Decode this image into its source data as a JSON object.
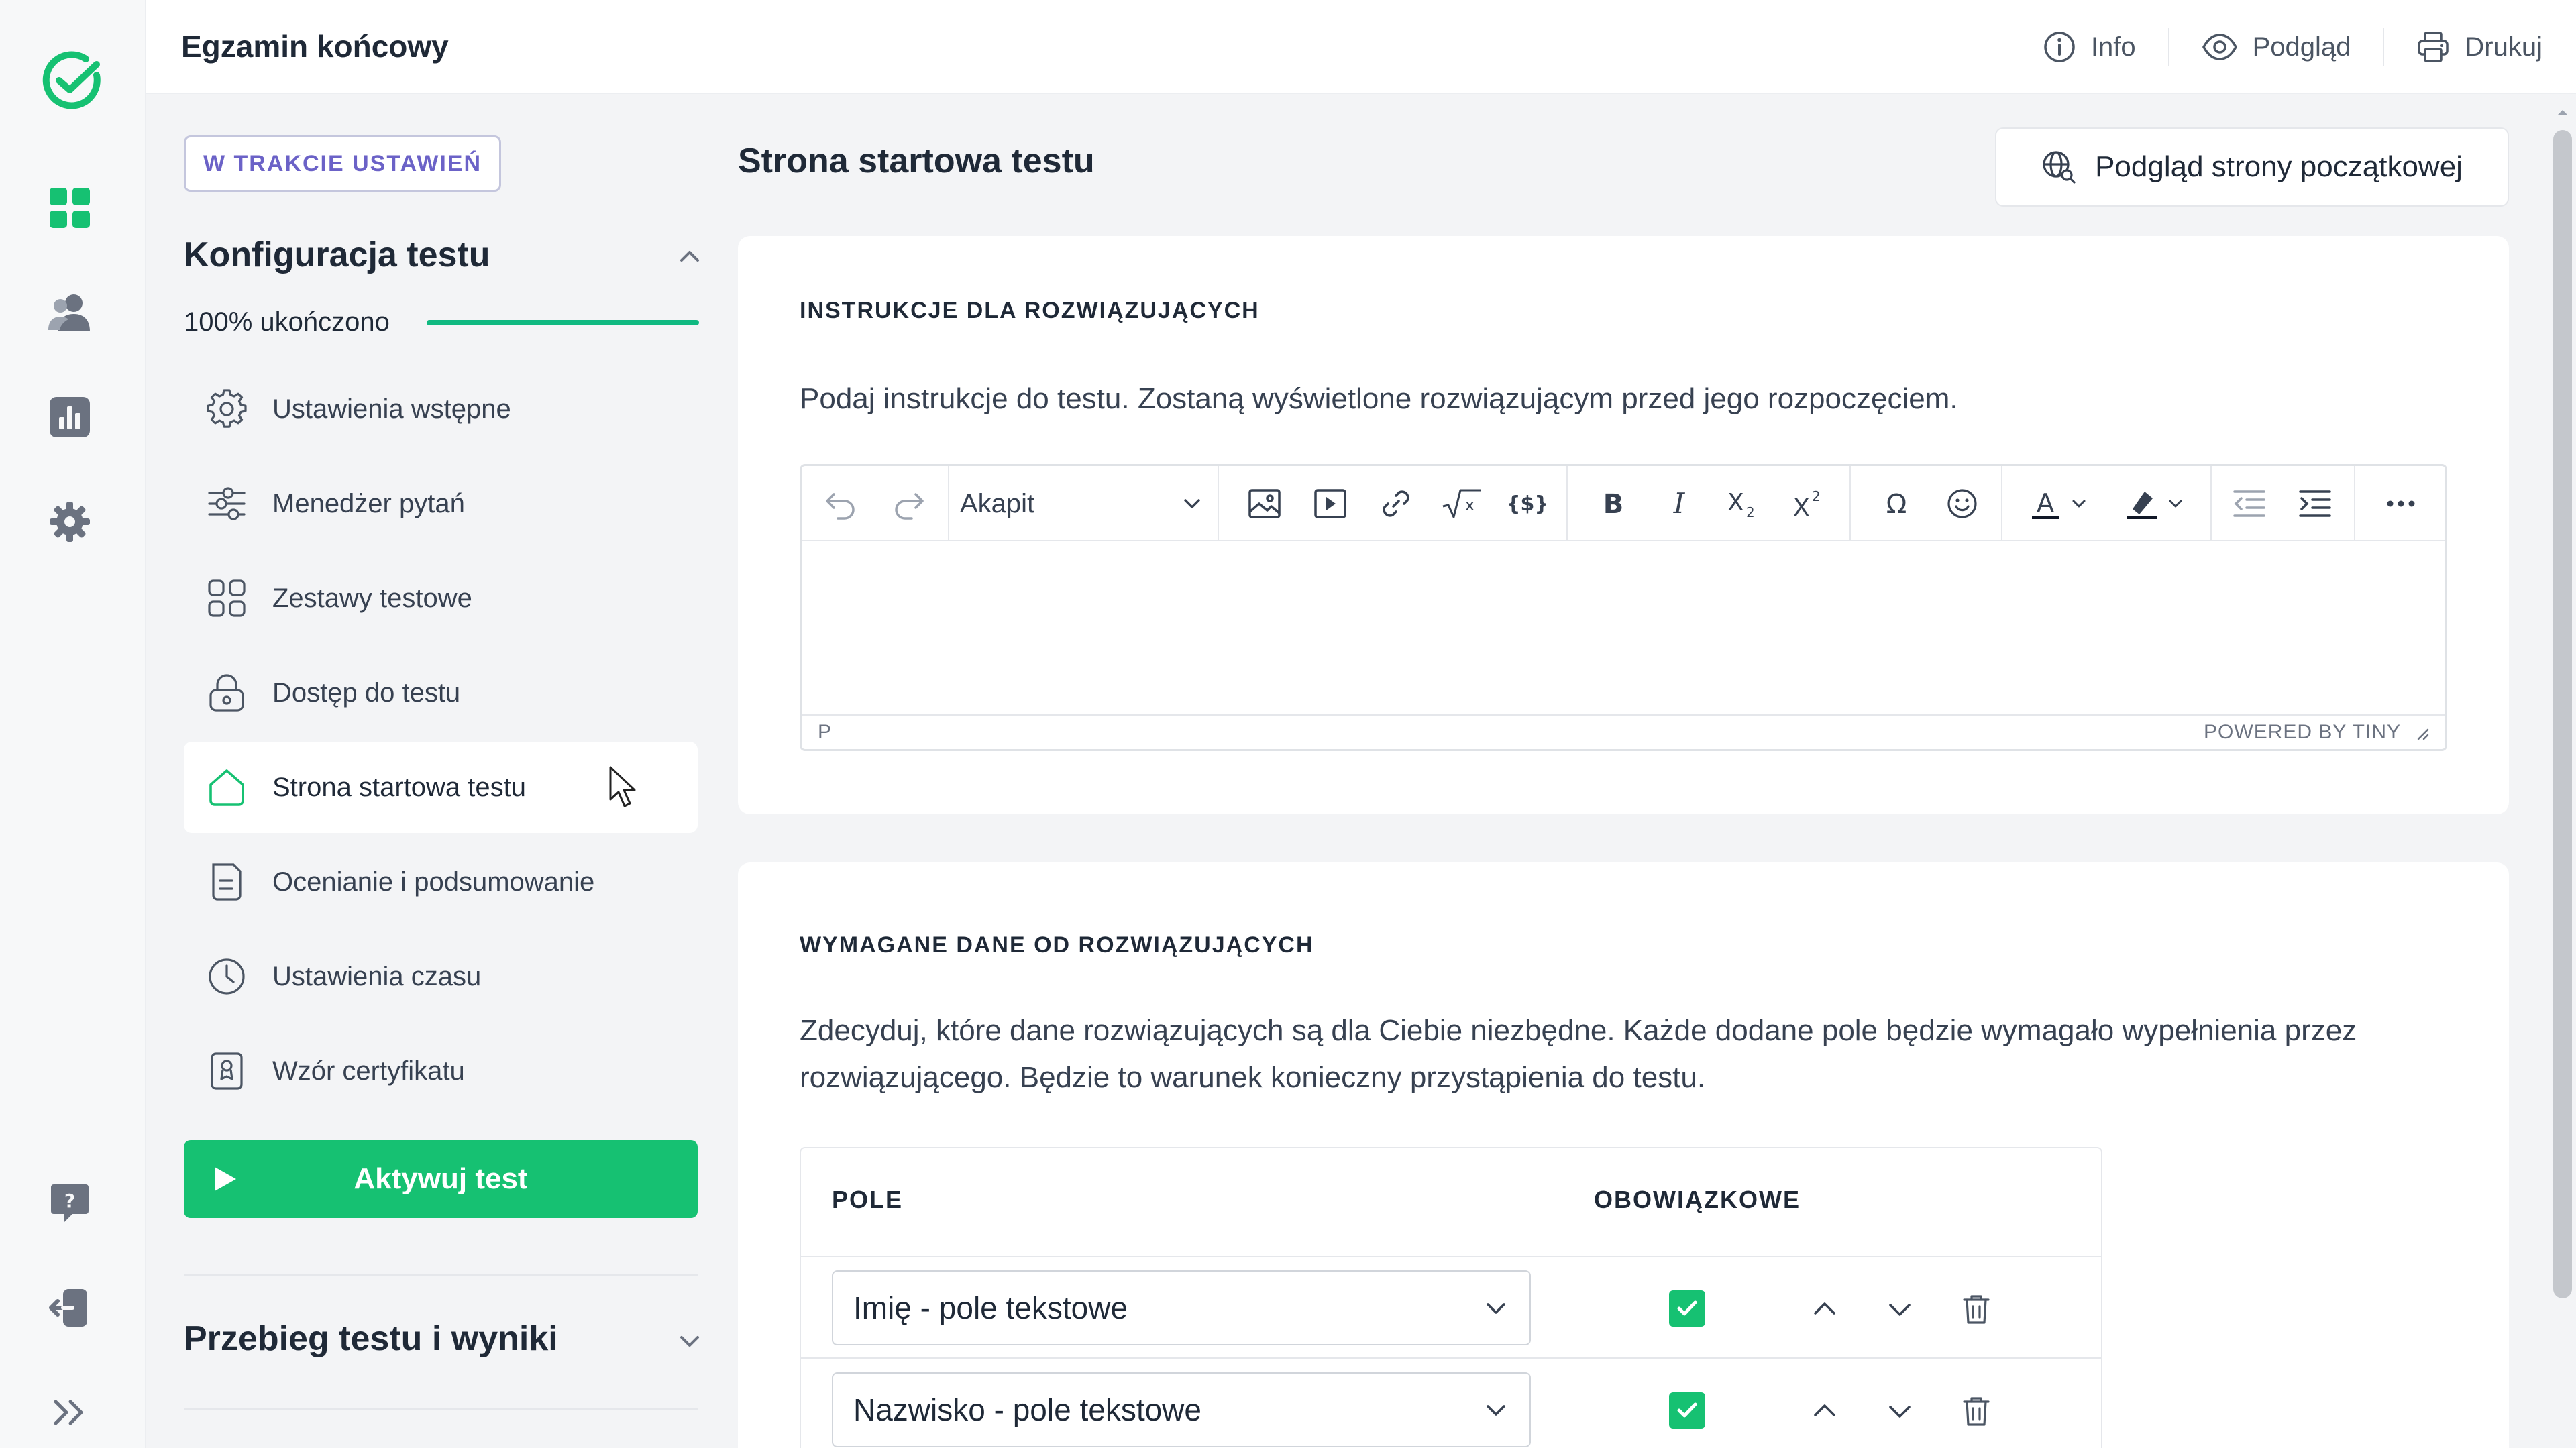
{
  "header": {
    "title": "Egzamin końcowy",
    "actions": [
      {
        "label": "Info",
        "icon": "info-icon"
      },
      {
        "label": "Podgląd",
        "icon": "eye-icon"
      },
      {
        "label": "Drukuj",
        "icon": "printer-icon"
      }
    ]
  },
  "rail": {
    "icons": [
      "logo-check-icon",
      "dashboard-grid-icon",
      "users-icon",
      "reports-chart-icon",
      "settings-gear-icon",
      "help-question-icon",
      "logout-icon",
      "expand-chevrons-icon"
    ]
  },
  "sidebar": {
    "status_badge": "W TRAKCIE USTAWIEŃ",
    "section1_title": "Konfiguracja testu",
    "progress_label": "100% ukończono",
    "progress_value": 100,
    "items": [
      {
        "label": "Ustawienia wstępne",
        "icon": "gear-icon"
      },
      {
        "label": "Menedżer pytań",
        "icon": "sliders-icon"
      },
      {
        "label": "Zestawy testowe",
        "icon": "grid-icon"
      },
      {
        "label": "Dostęp do testu",
        "icon": "lock-icon"
      },
      {
        "label": "Strona startowa testu",
        "icon": "home-icon",
        "active": true
      },
      {
        "label": "Ocenianie i podsumowanie",
        "icon": "document-icon"
      },
      {
        "label": "Ustawienia czasu",
        "icon": "clock-icon"
      },
      {
        "label": "Wzór certyfikatu",
        "icon": "certificate-icon"
      }
    ],
    "activate_label": "Aktywuj test",
    "section2_title": "Przebieg testu i wyniki"
  },
  "main": {
    "page_title": "Strona startowa testu",
    "preview_button": "Podgląd strony początkowej",
    "instructions": {
      "label": "INSTRUKCJE DLA ROZWIĄZUJĄCYCH",
      "description": "Podaj instrukcje do testu. Zostaną wyświetlone rozwiązującym przed jego rozpoczęciem.",
      "editor": {
        "block_format": "Akapit",
        "status_path": "P",
        "powered_by": "POWERED BY TINY"
      }
    },
    "required_data": {
      "label": "WYMAGANE DANE OD ROZWIĄZUJĄCYCH",
      "description": "Zdecyduj, które dane rozwiązujących są dla Ciebie niezbędne. Każde dodane pole będzie wymagało wypełnienia przez rozwiązującego. Będzie to warunek konieczny przystąpienia do testu.",
      "col_field": "POLE",
      "col_required": "OBOWIĄZKOWE",
      "rows": [
        {
          "field": "Imię - pole tekstowe",
          "required": true
        },
        {
          "field": "Nazwisko - pole tekstowe",
          "required": true
        }
      ]
    }
  },
  "colors": {
    "accent_green": "#16c172",
    "badge_purple": "#6b62c7"
  }
}
